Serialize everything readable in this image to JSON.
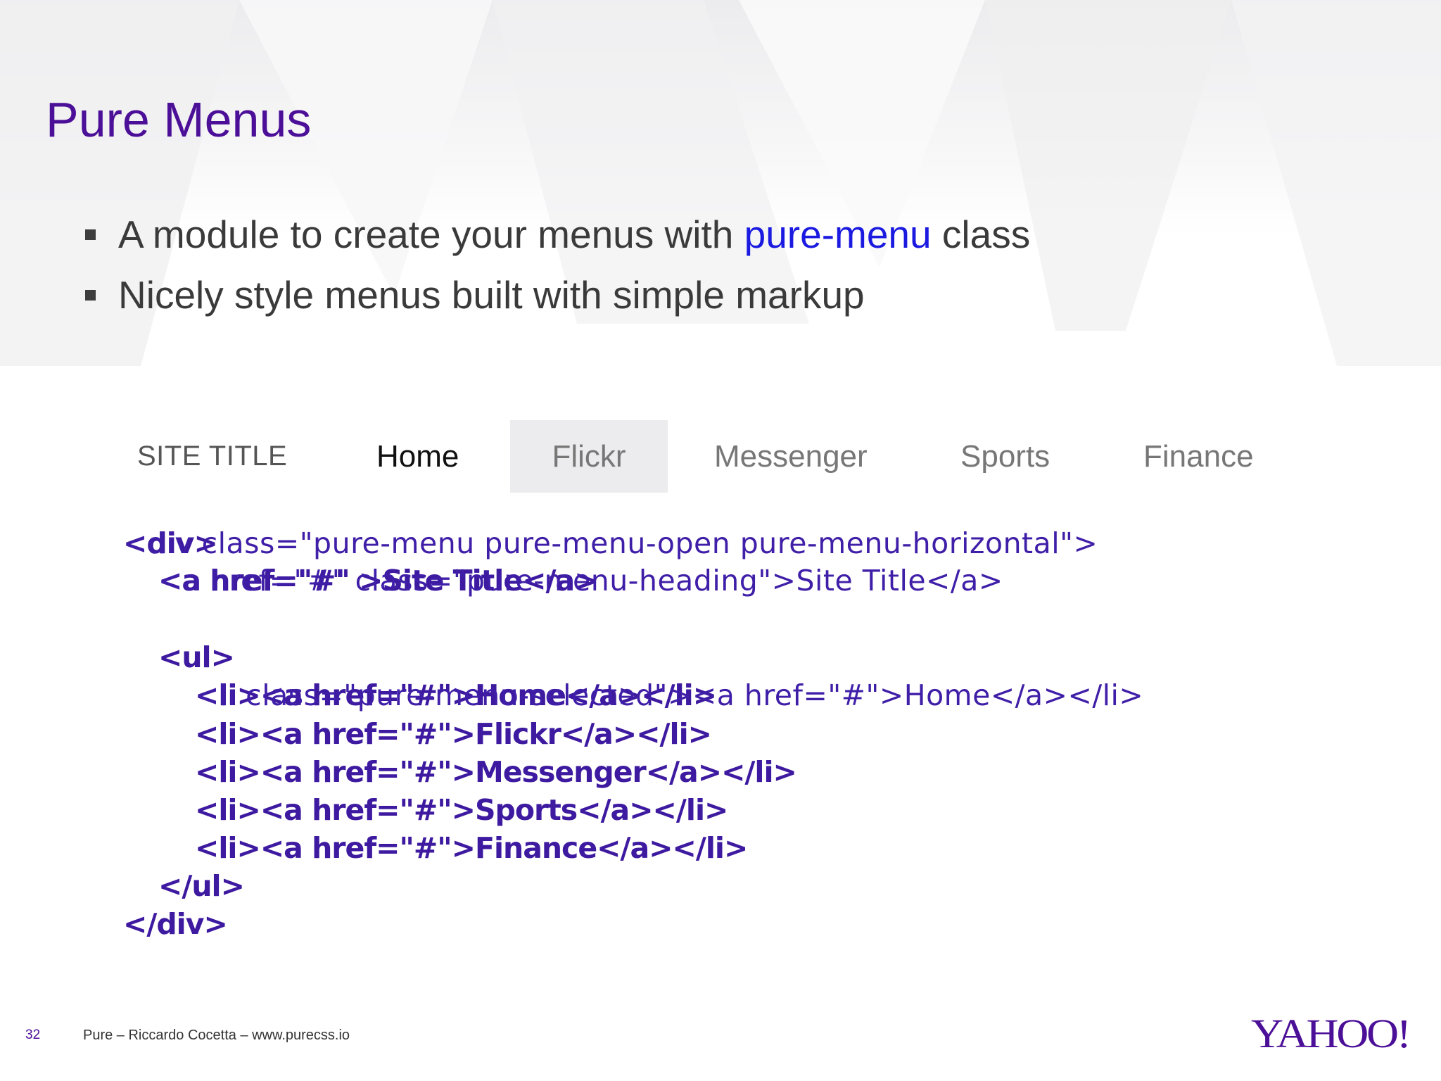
{
  "slide": {
    "title": "Pure Menus",
    "bullets": [
      {
        "before": "A module to create your menus with ",
        "highlight": "pure-menu",
        "after": " class"
      },
      {
        "before": "Nicely style menus built with simple markup",
        "highlight": "",
        "after": ""
      }
    ]
  },
  "menu_demo": {
    "heading": "SITE TITLE",
    "items": [
      "Home",
      "Flickr",
      "Messenger",
      "Sports",
      "Finance"
    ],
    "selected": "Home",
    "hovered": "Flickr"
  },
  "code": {
    "line1_bold": "<div>",
    "line1_thin": "<div class=\"pure-menu pure-menu-open pure-menu-horizontal\">",
    "line2_bold": "<a href=\"#\" >Site Title</a>",
    "line2_thin": "<a href=\"#\" class=\"pure-menu-heading\">Site Title</a>",
    "line3": "<ul>",
    "line4_bold": "<li><a href=\"#\">Home</a></li>",
    "line4_thin": "<li class=\"pure-menu-selected\"><a href=\"#\">Home</a></li>",
    "line5": "<li><a href=\"#\">Flickr</a></li>",
    "line6": "<li><a href=\"#\">Messenger</a></li>",
    "line7": "<li><a href=\"#\">Sports</a></li>",
    "line8": "<li><a href=\"#\">Finance</a></li>",
    "line9": "</ul>",
    "line10": "</div>"
  },
  "footer": {
    "page_number": "32",
    "text": "Pure – Riccardo Cocetta – www.purecss.io",
    "logo": "YAHOO!"
  },
  "colors": {
    "title": "#4b0f98",
    "highlight": "#1a1ae0",
    "code": "#3d1aa0",
    "menu_hover_bg": "#ececee"
  }
}
